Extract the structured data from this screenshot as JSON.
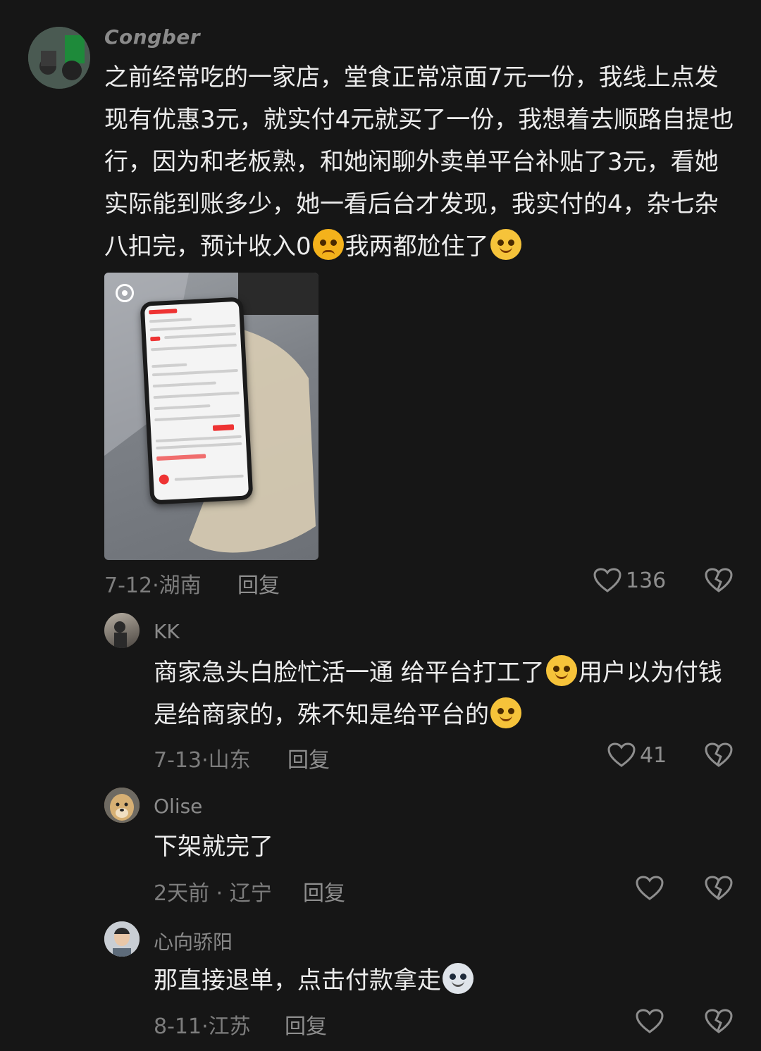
{
  "comments": [
    {
      "username": "Congber",
      "text_1": "之前经常吃的一家店，堂食正常凉面7元一份，我线上点发现有优惠3元，就实付4元就买了一份，我想着去顺路自提也行，因为和老板熟，和她闲聊外卖单平台补贴了3元，看她实际能到账多少，她一看后台才发现，我实付的4，杂七杂八扣完，预计收入0",
      "text_2": "我两都尬住了",
      "meta": "7-12·湖南",
      "reply_label": "回复",
      "likes": "136"
    },
    {
      "username": "KK",
      "text_1": "商家急头白脸忙活一通 给平台打工了",
      "text_2": "用户以为付钱是给商家的，殊不知是给平台的",
      "meta": "7-13·山东",
      "reply_label": "回复",
      "likes": "41"
    },
    {
      "username": "Olise",
      "text_1": "下架就完了",
      "meta": "2天前 · 辽宁",
      "reply_label": "回复",
      "likes": ""
    },
    {
      "username": "心向骄阳",
      "text_1": "那直接退单，点击付款拿走",
      "meta": "8-11·江苏",
      "reply_label": "回复",
      "likes": ""
    }
  ],
  "icons": {
    "like": "heart-outline-icon",
    "dislike": "broken-heart-icon"
  },
  "colors": {
    "background": "#161616",
    "text": "#ececec",
    "muted": "#7d7d7d"
  }
}
